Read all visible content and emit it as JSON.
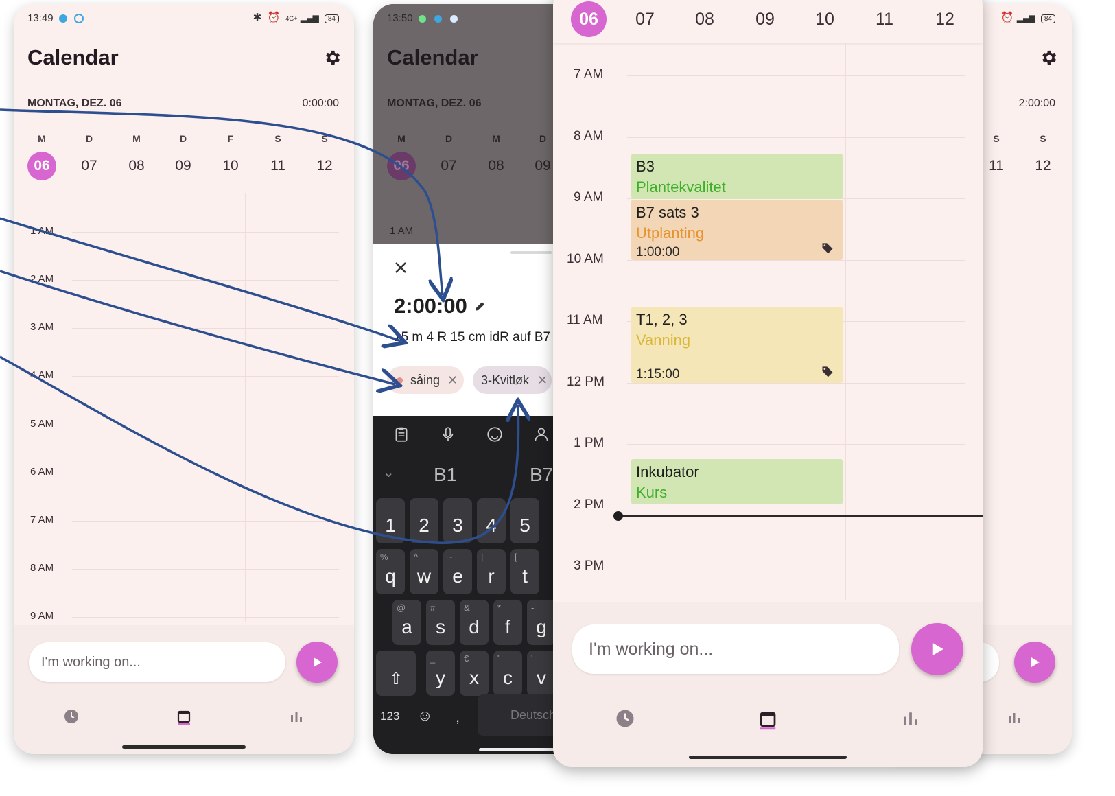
{
  "left_screen": {
    "status_time": "13:49",
    "status_right": "4G+",
    "battery": "84",
    "title": "Calendar",
    "date_label": "MONTAG, DEZ. 06",
    "timer": "0:00:00",
    "weekdays": [
      "M",
      "D",
      "M",
      "D",
      "F",
      "S",
      "S"
    ],
    "days": [
      "06",
      "07",
      "08",
      "09",
      "10",
      "11",
      "12"
    ],
    "hours": [
      "1 AM",
      "2 AM",
      "3 AM",
      "4 AM",
      "5 AM",
      "6 AM",
      "7 AM",
      "8 AM",
      "9 AM"
    ],
    "input_placeholder": "I'm working on..."
  },
  "middle_screen": {
    "status_time": "13:50",
    "title": "Calendar",
    "date_label": "MONTAG, DEZ. 06",
    "weekdays": [
      "M",
      "D",
      "M",
      "D"
    ],
    "days": [
      "06",
      "07",
      "08",
      "09"
    ],
    "hour_visible": "1 AM",
    "sheet": {
      "duration": "2:00:00",
      "description": "15 m 4 R 15 cm idR auf B7",
      "tags": [
        "såing",
        "3-Kvitløk"
      ]
    },
    "keyboard": {
      "suggestions": [
        "B1",
        "B7"
      ],
      "number_row": [
        "1",
        "2",
        "3",
        "4",
        "5"
      ],
      "row1": [
        {
          "k": "q",
          "s": "%"
        },
        {
          "k": "w",
          "s": "^"
        },
        {
          "k": "e",
          "s": "~"
        },
        {
          "k": "r",
          "s": "|"
        },
        {
          "k": "t",
          "s": "["
        }
      ],
      "row2": [
        {
          "k": "a",
          "s": "@"
        },
        {
          "k": "s",
          "s": "#"
        },
        {
          "k": "d",
          "s": "&"
        },
        {
          "k": "f",
          "s": "*"
        },
        {
          "k": "g",
          "s": "-"
        }
      ],
      "row3": [
        {
          "k": "y",
          "s": "_"
        },
        {
          "k": "x",
          "s": "€"
        },
        {
          "k": "c",
          "s": "\""
        },
        {
          "k": "v",
          "s": "'"
        }
      ],
      "num_key": "123",
      "comma": ",",
      "space_label": "Deutsch"
    }
  },
  "right_back_screen": {
    "battery": "84",
    "timer": "2:00:00",
    "weekdays": [
      "S",
      "S"
    ],
    "days": [
      "11",
      "12"
    ]
  },
  "right_screen": {
    "days": [
      "06",
      "07",
      "08",
      "09",
      "10",
      "11",
      "12"
    ],
    "hours": [
      "7 AM",
      "8 AM",
      "9 AM",
      "10 AM",
      "11 AM",
      "12 PM",
      "1 PM",
      "2 PM",
      "3 PM"
    ],
    "events": [
      {
        "title": "B3",
        "subtitle": "Plantekvalitet",
        "duration": "",
        "color": "#d2e6b4",
        "text_color": "#3fae2b"
      },
      {
        "title": "B7 sats 3",
        "subtitle": "Utplanting",
        "duration": "1:00:00",
        "color": "#f2d6b6",
        "text_color": "#e6922e"
      },
      {
        "title": "T1, 2, 3",
        "subtitle": "Vanning",
        "duration": "1:15:00",
        "color": "#f4e6b7",
        "text_color": "#d9b73a"
      },
      {
        "title": "Inkubator",
        "subtitle": "Kurs",
        "duration": "",
        "color": "#d2e6b4",
        "text_color": "#3fae2b"
      }
    ],
    "input_placeholder": "I'm working on..."
  },
  "colors": {
    "accent": "#d766d0",
    "arrow": "#2d4f8f",
    "background": "#fbf0ee"
  }
}
